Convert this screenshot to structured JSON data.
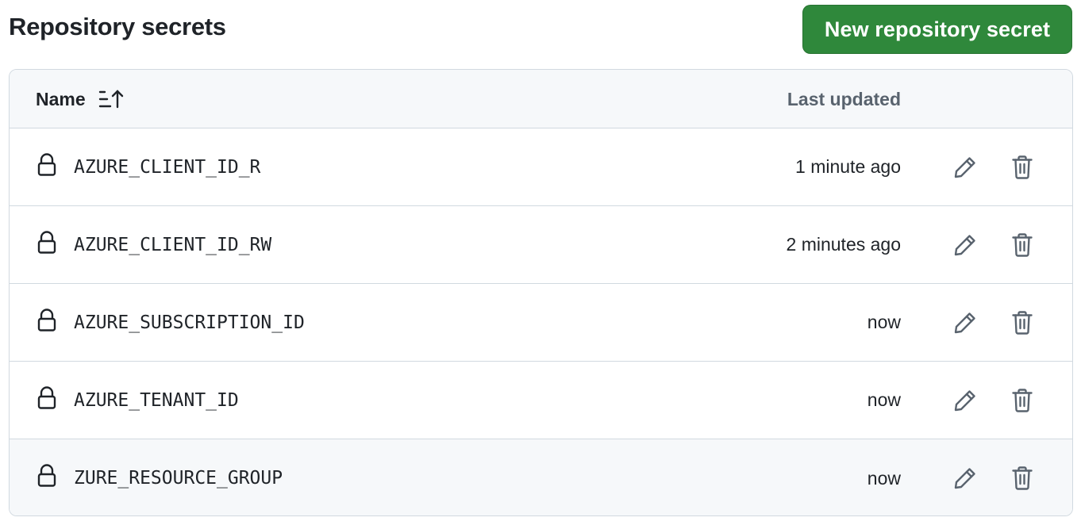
{
  "header": {
    "title": "Repository secrets",
    "new_secret_label": "New repository secret"
  },
  "table": {
    "columns": {
      "name": "Name",
      "last_updated": "Last updated"
    },
    "rows": [
      {
        "name": "AZURE_CLIENT_ID_R",
        "updated": "1 minute ago"
      },
      {
        "name": "AZURE_CLIENT_ID_RW",
        "updated": "2 minutes ago"
      },
      {
        "name": "AZURE_SUBSCRIPTION_ID",
        "updated": "now"
      },
      {
        "name": "AZURE_TENANT_ID",
        "updated": "now"
      },
      {
        "name": "ZURE_RESOURCE_GROUP",
        "updated": "now"
      }
    ]
  },
  "icons": {
    "sort": "sort-ascending-icon",
    "lock": "lock-icon",
    "edit": "pencil-icon",
    "delete": "trash-icon"
  },
  "colors": {
    "primary_button": "#2f883b",
    "border": "#d1d9e0",
    "header_bg": "#f6f8fa",
    "muted_text": "#59636e",
    "icon": "#59636e"
  }
}
